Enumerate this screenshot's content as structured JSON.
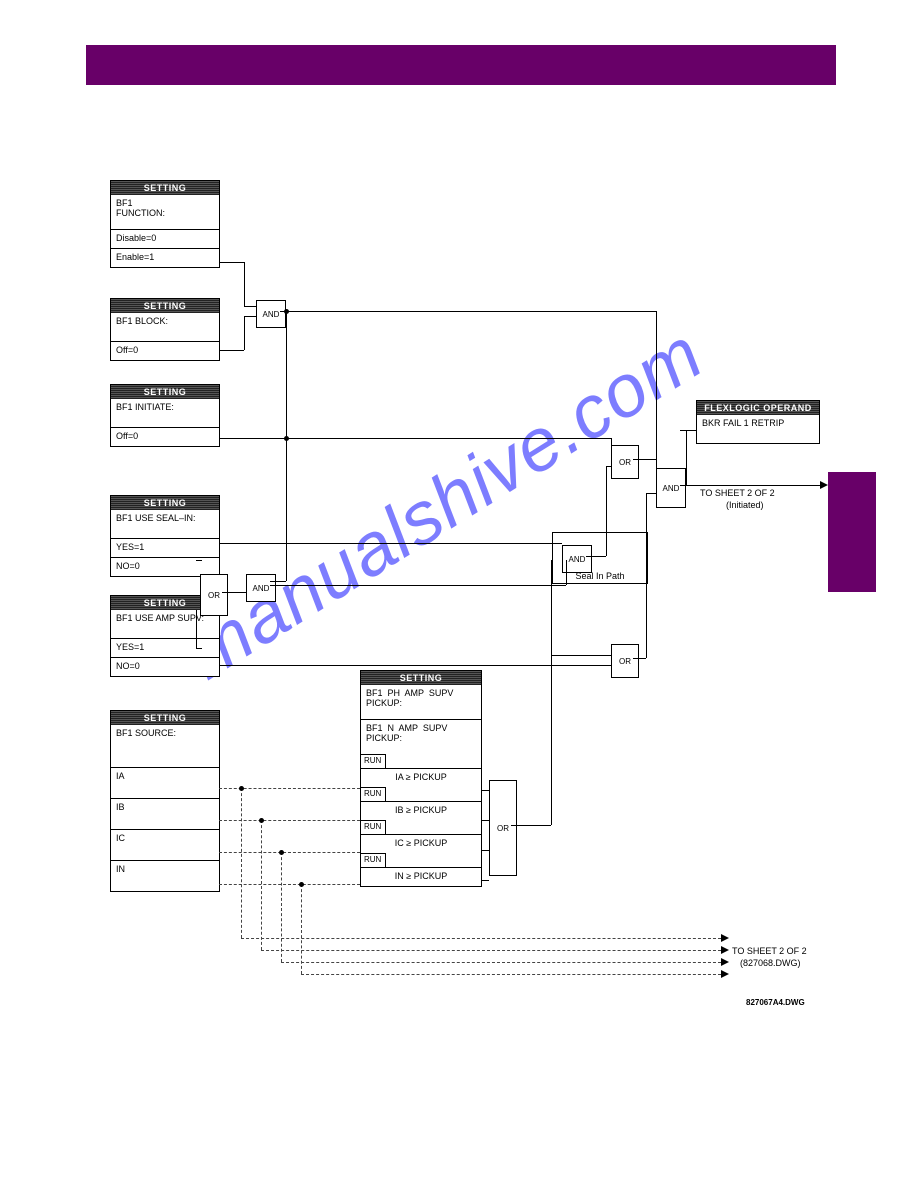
{
  "watermark": "manualshive.com",
  "drawing_ref": "827067A4.DWG",
  "to_sheet_1": "TO  SHEET  2  OF  2",
  "to_sheet_1_sub": "(Initiated)",
  "to_sheet_2": "TO  SHEET  2  OF  2",
  "to_sheet_2_sub": "(827068.DWG)",
  "seal_lbl": "Seal In Path",
  "flexlogic": {
    "hdr": "FLEXLOGIC OPERAND",
    "val": "BKR  FAIL  1  RETRIP"
  },
  "blocks": {
    "func": {
      "hdr": "SETTING",
      "name": "BF1\nFUNCTION:",
      "r1": "Disable=0",
      "r2": "Enable=1"
    },
    "block": {
      "hdr": "SETTING",
      "name": "BF1  BLOCK:",
      "r1": "Off=0"
    },
    "init": {
      "hdr": "SETTING",
      "name": "BF1  INITIATE:",
      "r1": "Off=0"
    },
    "seal": {
      "hdr": "SETTING",
      "name": "BF1  USE  SEAL–IN:",
      "r1": "YES=1",
      "r2": "NO=0"
    },
    "amp": {
      "hdr": "SETTING",
      "name": "BF1  USE  AMP  SUPV:",
      "r1": "YES=1",
      "r2": "NO=0"
    },
    "src": {
      "hdr": "SETTING",
      "name": "BF1  SOURCE:",
      "r1": "IA",
      "r2": "IB",
      "r3": "IC",
      "r4": "IN"
    },
    "pkp": {
      "hdr": "SETTING",
      "n1": "BF1  PH  AMP  SUPV\nPICKUP:",
      "n2": "BF1  N  AMP  SUPV\nPICKUP:",
      "run": "RUN",
      "c1": "IA  ≥  PICKUP",
      "c2": "IB  ≥  PICKUP",
      "c3": "IC  ≥  PICKUP",
      "c4": "IN  ≥  PICKUP"
    }
  },
  "gates": {
    "and": "AND",
    "or": "OR"
  }
}
